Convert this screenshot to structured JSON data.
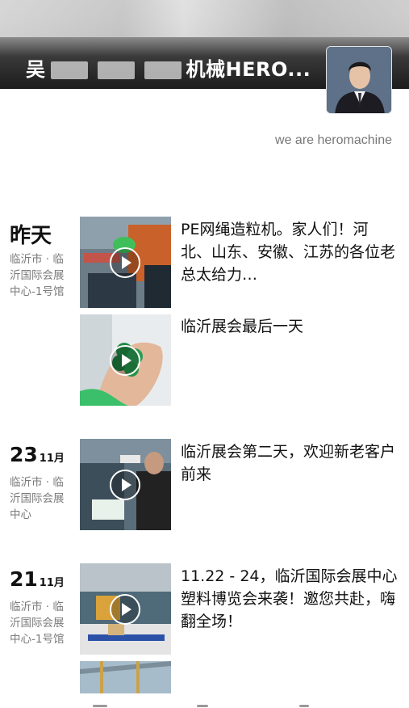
{
  "profile": {
    "nickname_start": "吴",
    "nickname_end": "机械HERO...",
    "signature": "we are heromachine"
  },
  "posts": [
    {
      "date_label": "昨天",
      "location": "临沂市 · 临沂国际会展中心-1号馆",
      "entries": [
        {
          "text": "PE网绳造粒机。家人们！河北、山东、安徽、江苏的各位老总太给力…"
        },
        {
          "text": "临沂展会最后一天"
        }
      ]
    },
    {
      "day": "23",
      "month": "11月",
      "location": "临沂市 · 临沂国际会展中心",
      "entries": [
        {
          "text": "临沂展会第二天，欢迎新老客户前来"
        }
      ]
    },
    {
      "day": "21",
      "month": "11月",
      "location": "临沂市 · 临沂国际会展中心-1号馆",
      "entries": [
        {
          "text": "11.22 - 24，临沂国际会展中心塑料博览会来袭！邀您共赴，嗨翻全场！"
        }
      ]
    }
  ],
  "icons": {
    "play": "play-icon",
    "avatar": "user-avatar"
  }
}
